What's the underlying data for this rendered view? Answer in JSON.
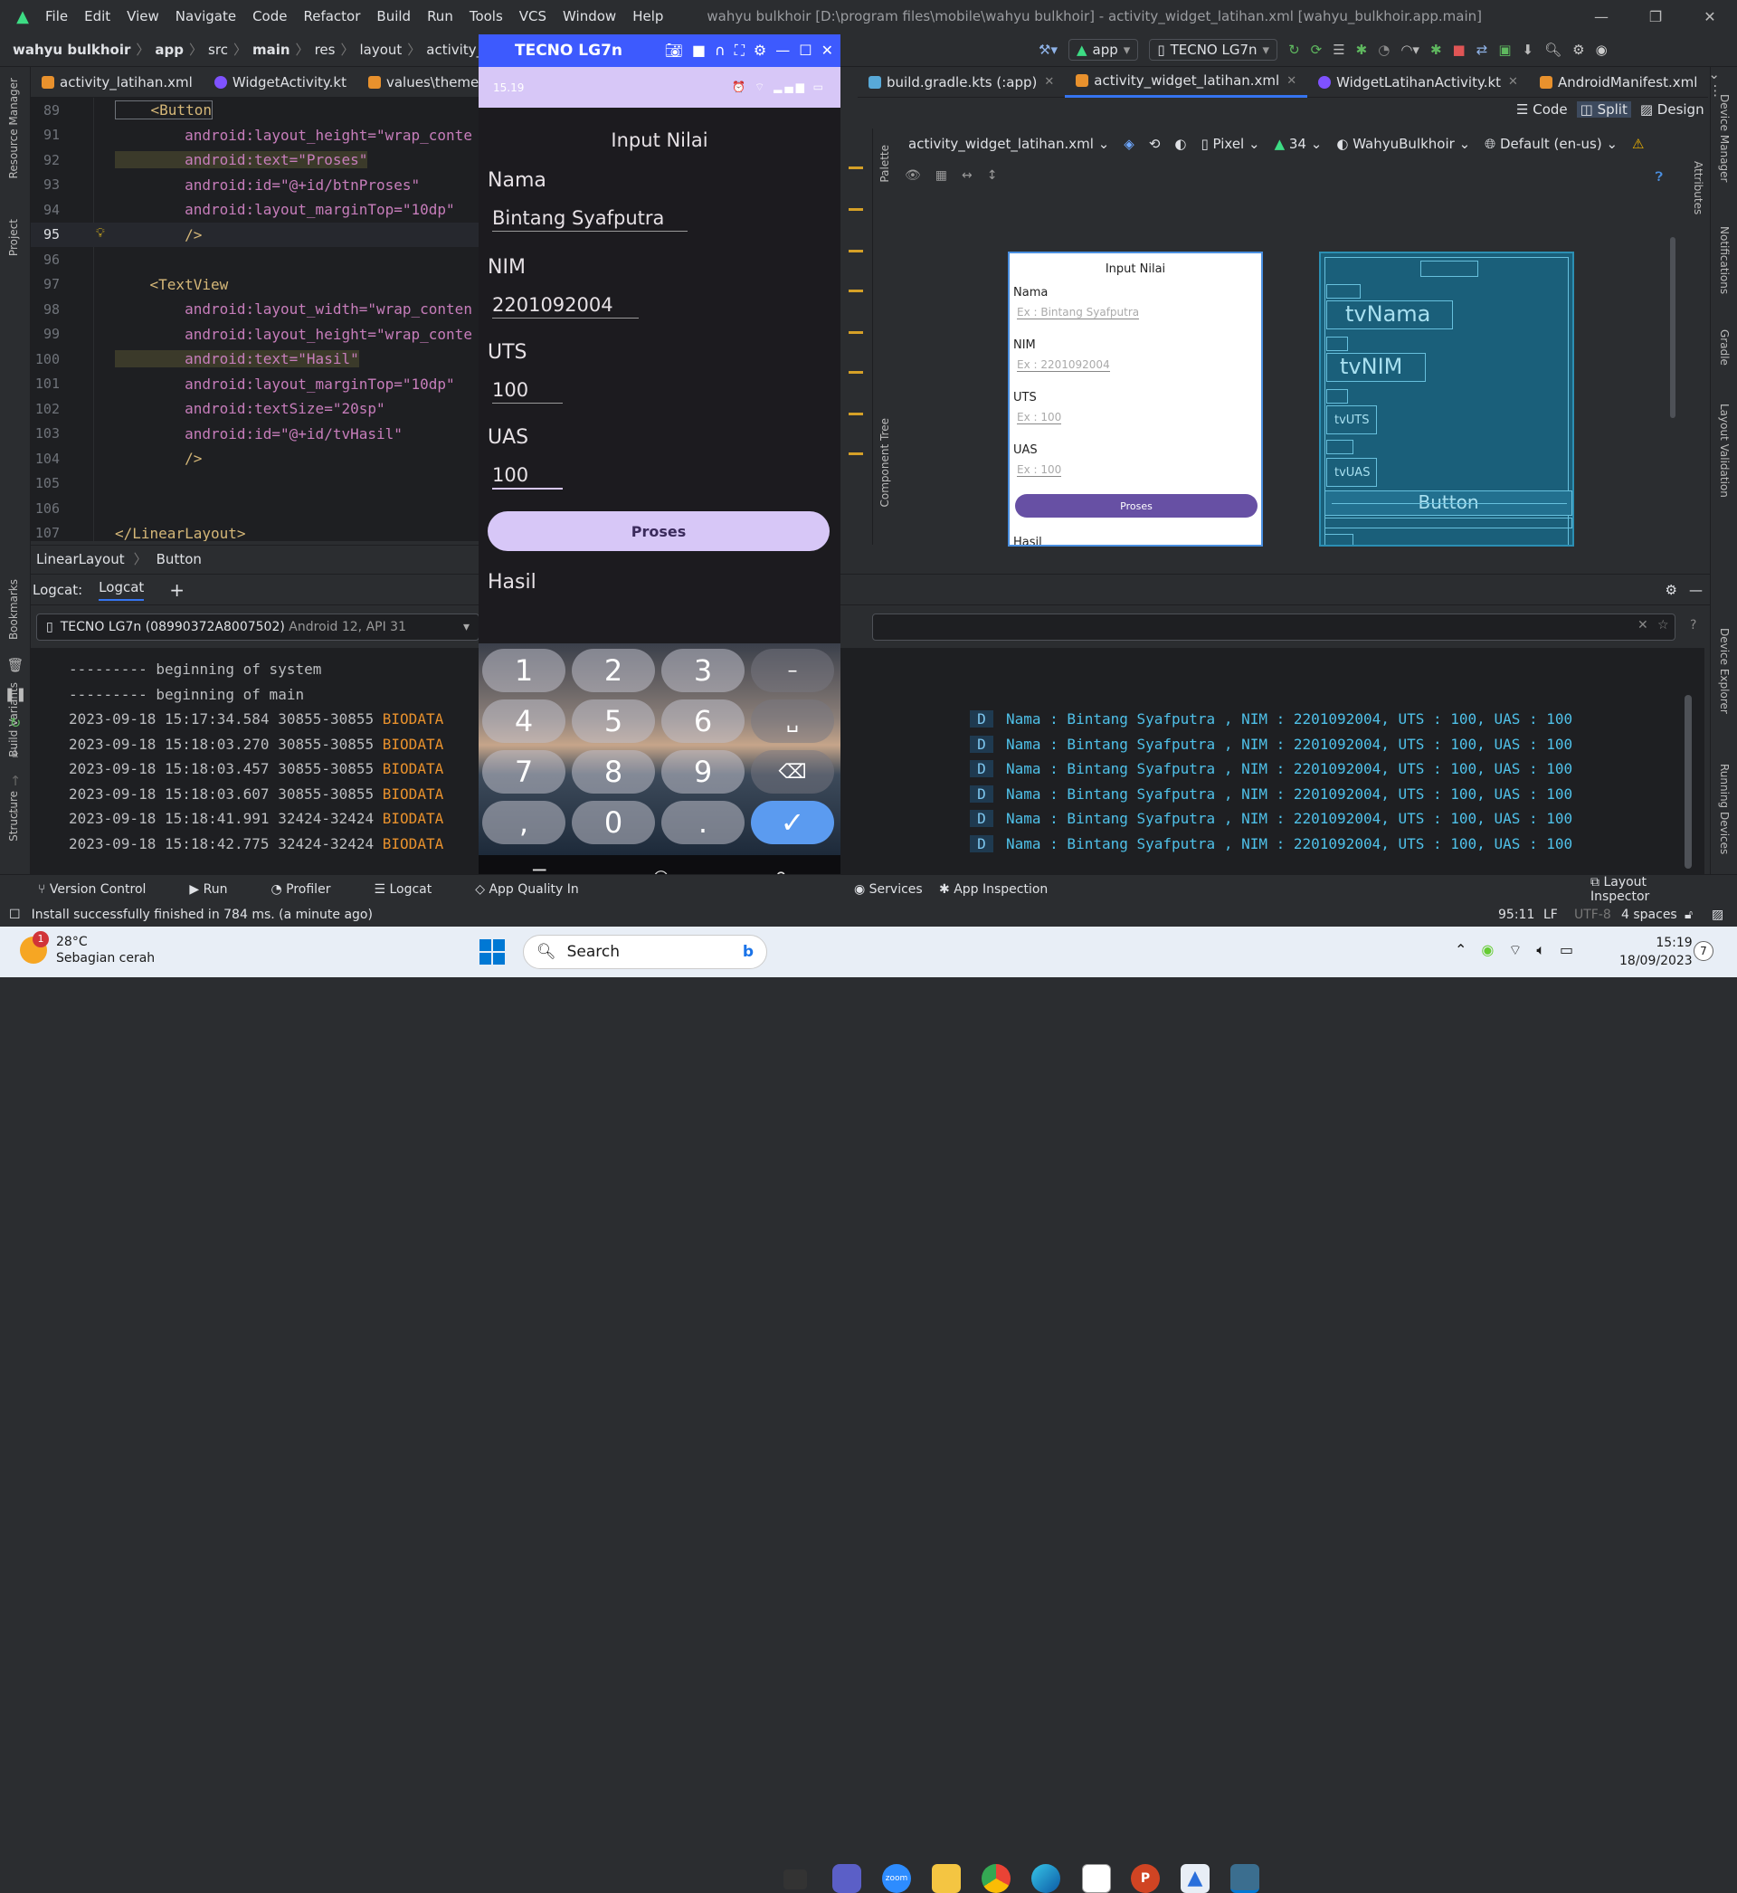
{
  "title_bar": {
    "menu": [
      "File",
      "Edit",
      "View",
      "Navigate",
      "Code",
      "Refactor",
      "Build",
      "Run",
      "Tools",
      "VCS",
      "Window",
      "Help"
    ],
    "window_title": "wahyu bulkhoir [D:\\program files\\mobile\\wahyu bulkhoir] - activity_widget_latihan.xml [wahyu_bulkhoir.app.main]"
  },
  "breadcrumb": {
    "items": [
      "wahyu bulkhoir",
      "app",
      "src",
      "main",
      "res",
      "layout",
      "activity_widget_lat"
    ]
  },
  "toolbar": {
    "run_config": "app",
    "device": "TECNO LG7n"
  },
  "editor_tabs": [
    {
      "label": "activity_latihan.xml",
      "color": "#e8912d"
    },
    {
      "label": "WidgetActivity.kt",
      "color": "#7f52ff"
    },
    {
      "label": "values\\themes.x",
      "color": "#e8912d"
    },
    {
      "label": "build.gradle.kts (:app)",
      "color": "#58a9d8"
    },
    {
      "label": "activity_widget_latihan.xml",
      "color": "#e8912d",
      "active": true
    },
    {
      "label": "WidgetLatihanActivity.kt",
      "color": "#7f52ff"
    },
    {
      "label": "AndroidManifest.xml",
      "color": "#e8912d"
    }
  ],
  "view_modes": {
    "code": "Code",
    "split": "Split",
    "design": "Design"
  },
  "code_lines": [
    {
      "n": "89",
      "t": "    <Button"
    },
    {
      "n": "91",
      "t": "        android:layout_height=\"wrap_conte"
    },
    {
      "n": "92",
      "t": "        android:text=\"Proses\""
    },
    {
      "n": "93",
      "t": "        android:id=\"@+id/btnProses\""
    },
    {
      "n": "94",
      "t": "        android:layout_marginTop=\"10dp\""
    },
    {
      "n": "95",
      "t": "        />"
    },
    {
      "n": "96",
      "t": ""
    },
    {
      "n": "97",
      "t": "    <TextView"
    },
    {
      "n": "98",
      "t": "        android:layout_width=\"wrap_conten"
    },
    {
      "n": "99",
      "t": "        android:layout_height=\"wrap_conte"
    },
    {
      "n": "100",
      "t": "        android:text=\"Hasil\""
    },
    {
      "n": "101",
      "t": "        android:layout_marginTop=\"10dp\""
    },
    {
      "n": "102",
      "t": "        android:textSize=\"20sp\""
    },
    {
      "n": "103",
      "t": "        android:id=\"@+id/tvHasil\""
    },
    {
      "n": "104",
      "t": "        />"
    },
    {
      "n": "105",
      "t": ""
    },
    {
      "n": "106",
      "t": ""
    },
    {
      "n": "107",
      "t": "</LinearLayout>"
    }
  ],
  "editor_breadcrumb": [
    "LinearLayout",
    "Button"
  ],
  "emulator": {
    "title": "TECNO LG7n",
    "status_time": "15.19",
    "app": {
      "heading": "Input Nilai",
      "nama_label": "Nama",
      "nama_value": "Bintang Syafputra",
      "nim_label": "NIM",
      "nim_value": "2201092004",
      "uts_label": "UTS",
      "uts_value": "100",
      "uas_label": "UAS",
      "uas_value": "100",
      "button": "Proses",
      "hasil": "Hasil"
    },
    "keypad": [
      "1",
      "2",
      "3",
      "–",
      "4",
      "5",
      "6",
      "␣",
      "7",
      "8",
      "9",
      "⌫",
      ",",
      "0",
      ".",
      "✓"
    ]
  },
  "design_toolbar": {
    "file": "activity_widget_latihan.xml",
    "device": "Pixel",
    "api": "34",
    "theme": "WahyuBulkhoir",
    "locale": "Default (en-us)"
  },
  "design_preview": {
    "heading": "Input Nilai",
    "nama": "Nama",
    "nama_hint": "Ex : Bintang Syafputra",
    "nim": "NIM",
    "nim_hint": "Ex : 2201092004",
    "uts": "UTS",
    "uts_hint": "Ex : 100",
    "uas": "UAS",
    "uas_hint": "Ex : 100",
    "button": "Proses",
    "hasil": "Hasil"
  },
  "blueprint": {
    "tvNama": "tvNama",
    "tvNIM": "tvNIM",
    "tvUTS": "tvUTS",
    "tvUAS": "tvUAS",
    "button": "Button"
  },
  "logcat": {
    "label": "Logcat:",
    "tab": "Logcat",
    "device": "TECNO LG7n (08990372A8007502)",
    "device_api": "Android 12, API 31",
    "left_lines": [
      "--------- beginning of system",
      "--------- beginning of main",
      "2023-09-18 15:17:34.584 30855-30855 BIODATA",
      "2023-09-18 15:18:03.270 30855-30855 BIODATA",
      "2023-09-18 15:18:03.457 30855-30855 BIODATA",
      "2023-09-18 15:18:03.607 30855-30855 BIODATA",
      "2023-09-18 15:18:41.991 32424-32424 BIODATA",
      "2023-09-18 15:18:42.775 32424-32424 BIODATA"
    ],
    "right_level": "D",
    "right_msg": "Nama : Bintang Syafputra , NIM : 2201092004, UTS : 100, UAS : 100"
  },
  "tool_windows": [
    "Version Control",
    "Run",
    "Profiler",
    "Logcat",
    "App Quality In",
    "Services",
    "App Inspection",
    "Layout Inspector"
  ],
  "status": {
    "message": "Install successfully finished in 784 ms. (a minute ago)",
    "position": "95:11",
    "line_sep": "LF",
    "encoding": "UTF-8",
    "indent": "4 spaces"
  },
  "taskbar": {
    "weather_temp": "28°C",
    "weather_desc": "Sebagian cerah",
    "weather_badge": "1",
    "search": "Search",
    "time": "15:19",
    "date": "18/09/2023",
    "notif": "7"
  },
  "side_left": [
    "Resource Manager",
    "Project",
    "Bookmarks",
    "Build Variants",
    "Structure"
  ],
  "side_right": [
    "Device Manager",
    "Notifications",
    "Gradle",
    "Layout Validation",
    "Device Explorer",
    "Running Devices"
  ],
  "palette": [
    "Palette",
    "Component Tree"
  ],
  "attributes": "Attributes"
}
